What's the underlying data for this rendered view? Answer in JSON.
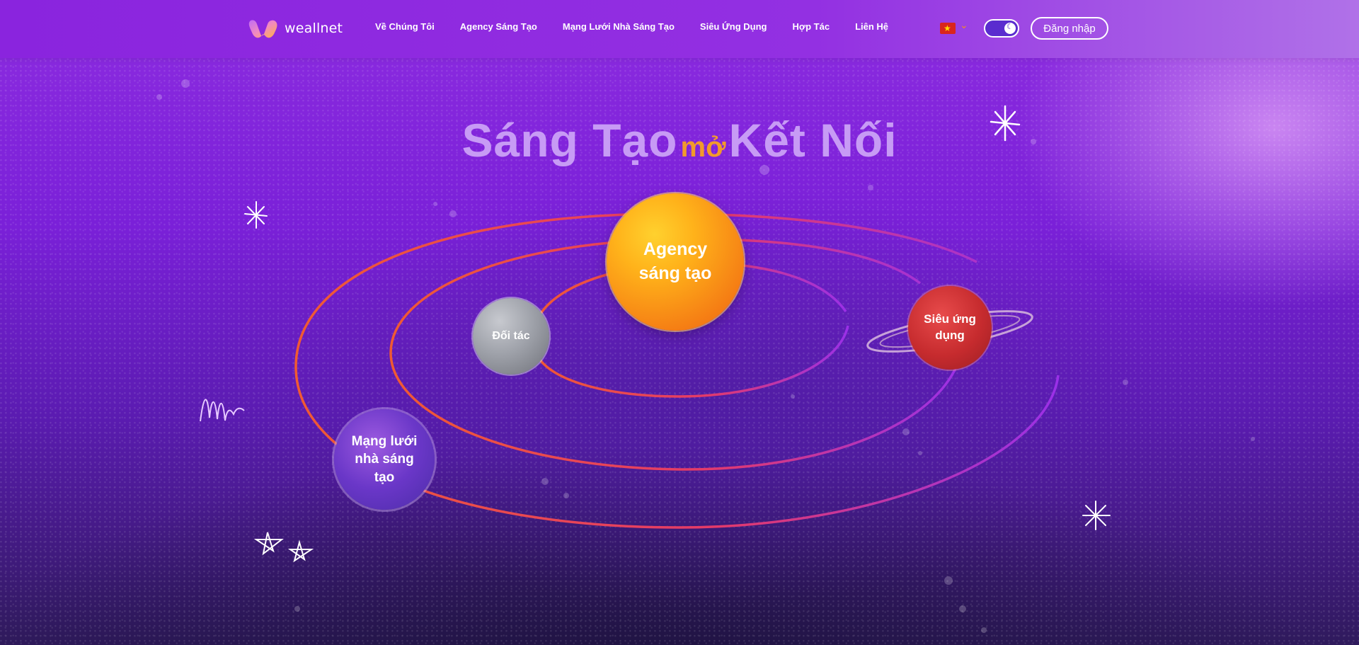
{
  "header": {
    "logo_text": "weallnet",
    "nav": [
      "Về Chúng Tôi",
      "Agency Sáng Tạo",
      "Mạng Lưới Nhà Sáng Tạo",
      "Siêu Ứng Dụng",
      "Hợp Tác",
      "Liên Hệ"
    ],
    "language_flag": "vietnam-flag-icon",
    "login_label": "Đăng nhập",
    "theme_toggle_icon": "moon-icon"
  },
  "hero": {
    "title_left": "Sáng Tạo",
    "title_mid": "mở",
    "title_right": "Kết Nối"
  },
  "planets": {
    "agency": "Agency sáng tạo",
    "doitac": "Đối tác",
    "mangluoi": "Mạng lưới nhà sáng tạo",
    "sieu": "Siêu ứng dụng"
  },
  "colors": {
    "accent": "#f29a2b",
    "title": "#c79bf5",
    "header_bg": "#8a24de",
    "agency_planet": "#f57d14",
    "partner_planet": "#9fa2aa",
    "network_planet": "#6a37c8",
    "app_planet": "#c62b2e"
  }
}
